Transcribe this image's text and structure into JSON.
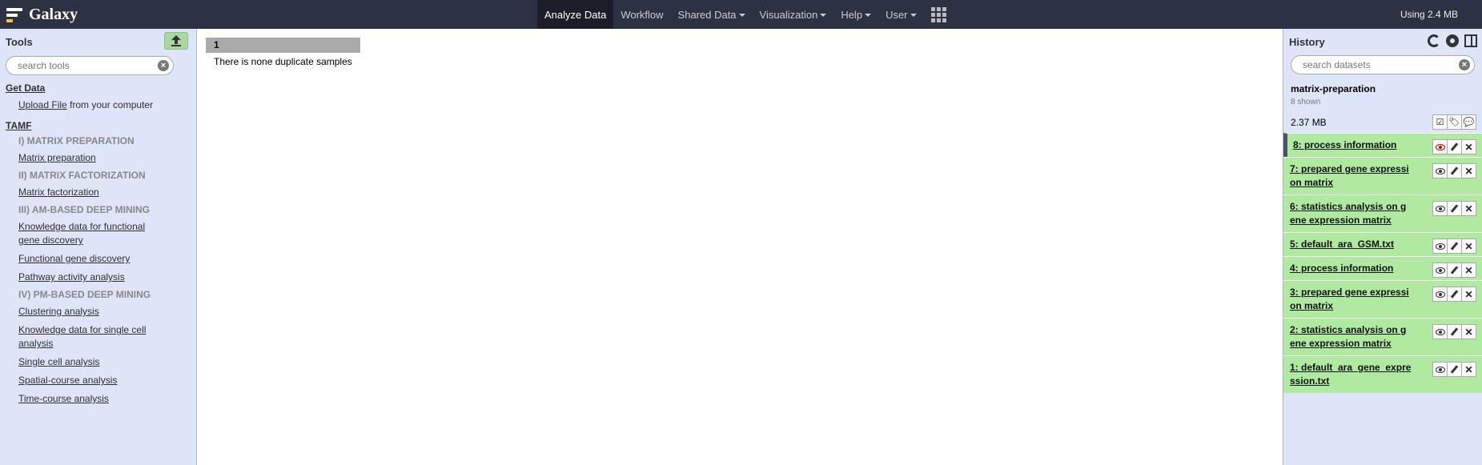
{
  "masthead": {
    "brand": "Galaxy",
    "nav": [
      {
        "label": "Analyze Data",
        "caret": false,
        "active": true
      },
      {
        "label": "Workflow",
        "caret": false,
        "active": false
      },
      {
        "label": "Shared Data",
        "caret": true,
        "active": false
      },
      {
        "label": "Visualization",
        "caret": true,
        "active": false
      },
      {
        "label": "Help",
        "caret": true,
        "active": false
      },
      {
        "label": "User",
        "caret": true,
        "active": false
      }
    ],
    "apps_icon": "apps-grid-icon",
    "quota": "Using 2.4 MB"
  },
  "tools": {
    "title": "Tools",
    "upload_icon": "upload-icon",
    "search_placeholder": "search tools",
    "get_data": {
      "label": "Get Data",
      "upload_link": "Upload File",
      "upload_suffix": " from your computer"
    },
    "tamf_label": "TAMF",
    "items": [
      {
        "kind": "label",
        "text": "I) MATRIX PREPARATION"
      },
      {
        "kind": "link",
        "text": "Matrix preparation"
      },
      {
        "kind": "label",
        "text": "II) MATRIX FACTORIZATION"
      },
      {
        "kind": "link",
        "text": "Matrix factorization"
      },
      {
        "kind": "label",
        "text": "III) AM-BASED DEEP MINING"
      },
      {
        "kind": "link",
        "text": "Knowledge data for functional gene discovery"
      },
      {
        "kind": "link",
        "text": "Functional gene discovery"
      },
      {
        "kind": "link",
        "text": "Pathway activity analysis"
      },
      {
        "kind": "label",
        "text": "IV) PM-BASED DEEP MINING"
      },
      {
        "kind": "link",
        "text": "Clustering analysis"
      },
      {
        "kind": "link",
        "text": "Knowledge data for single cell analysis"
      },
      {
        "kind": "link",
        "text": "Single cell analysis"
      },
      {
        "kind": "link",
        "text": "Spatial-course analysis"
      },
      {
        "kind": "link",
        "text": "Time-course analysis"
      }
    ]
  },
  "center": {
    "column_header": "1",
    "message": "There is none duplicate samples"
  },
  "history": {
    "title": "History",
    "search_placeholder": "search datasets",
    "name": "matrix-preparation",
    "shown": "8 shown",
    "size": "2.37 MB",
    "datasets": [
      {
        "title": "8: process information",
        "selected": true
      },
      {
        "title": "7: prepared gene expression matrix",
        "selected": false
      },
      {
        "title": "6: statistics analysis on gene expression matrix",
        "selected": false
      },
      {
        "title": "5: default_ara_GSM.txt",
        "selected": false
      },
      {
        "title": "4: process information",
        "selected": false
      },
      {
        "title": "3: prepared gene expression matrix",
        "selected": false
      },
      {
        "title": "2: statistics analysis on gene expression matrix",
        "selected": false
      },
      {
        "title": "1: default_ara_gene_expression.txt",
        "selected": false
      }
    ],
    "colors": {
      "dataset_ok": "#b0e9a0",
      "panel": "#dfe5f9",
      "masthead": "#2c3143"
    }
  }
}
